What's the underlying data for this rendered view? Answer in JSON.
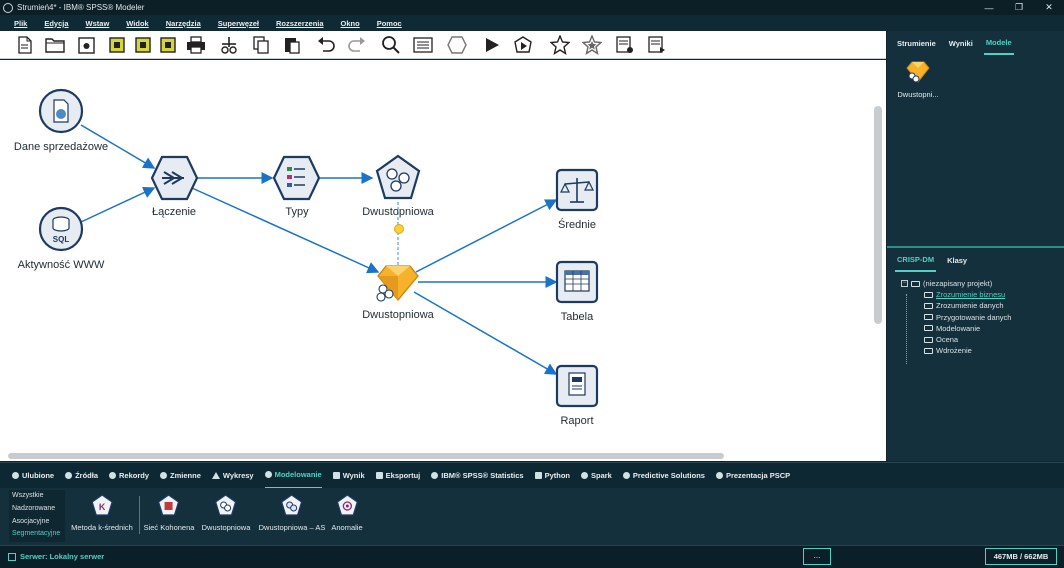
{
  "window": {
    "title": "Strumień4* - IBM® SPSS® Modeler",
    "minimize": "—",
    "maximize": "❐",
    "close": "✕"
  },
  "menu": [
    "Plik",
    "Edycja",
    "Wstaw",
    "Widok",
    "Narzędzia",
    "Superwęzeł",
    "Rozszerzenia",
    "Okno",
    "Pomoc"
  ],
  "toolbar": {
    "icons": [
      "new-stream-icon",
      "open-folder-icon",
      "save-icon",
      "node-a-icon",
      "node-b-icon",
      "node-c-icon",
      "print-icon",
      "cut-icon",
      "copy-icon",
      "paste-icon",
      "undo-icon",
      "redo-icon",
      "search-icon",
      "preview-icon",
      "superwezel-icon",
      "run-icon",
      "run-selection-icon",
      "favorite-icon",
      "favorite-outline-icon",
      "annotation-icon",
      "comment-icon"
    ]
  },
  "canvas": {
    "nodes": {
      "dane_sprzedazowe": "Dane sprzedażowe",
      "aktywnosc_www": "Aktywność WWW",
      "laczenie": "Łączenie",
      "typy": "Typy",
      "dwustopniowa_model": "Dwustopniowa",
      "dwustopniowa_nugget": "Dwustopniowa",
      "srednie": "Średnie",
      "tabela": "Tabela",
      "raport": "Raport"
    },
    "colors": {
      "node_fill": "#e6ecf2",
      "node_stroke": "#1d3a60",
      "link": "#1a73c9",
      "nugget": "#f5b22a"
    }
  },
  "right_top": {
    "tabs": [
      "Strumienie",
      "Wyniki",
      "Modele"
    ],
    "active_tab": 2,
    "model_label": "Dwustopni..."
  },
  "right_bottom": {
    "tabs": [
      "CRISP-DM",
      "Klasy"
    ],
    "active_tab": 0,
    "root": "(niezapisany projekt)",
    "items": [
      "Zrozumienie biznesu",
      "Zrozumienie danych",
      "Przygotowanie danych",
      "Modelowanie",
      "Ocena",
      "Wdrożenie"
    ],
    "current_item": 0
  },
  "palette_tabs": [
    "Ulubione",
    "Źródła",
    "Rekordy",
    "Zmienne",
    "Wykresy",
    "Modelowanie",
    "Wynik",
    "Eksportuj",
    "IBM® SPSS® Statistics",
    "Python",
    "Spark",
    "Predictive Solutions",
    "Prezentacja PSCP"
  ],
  "palette_active_tab": 5,
  "palette": {
    "categories": [
      "Wszystkie",
      "Nadzorowane",
      "Asocjacyjne",
      "Segmentacyjne"
    ],
    "active_category": 3,
    "nodes": [
      "Metoda k-średnich",
      "Sieć Kohonena",
      "Dwustopniowa",
      "Dwustopniowa – AS",
      "Anomalie"
    ]
  },
  "status": {
    "server": "Serwer: Lokalny serwer",
    "button": "...",
    "memory": "467MB / 662MB"
  },
  "accent": "#4fd1c5"
}
